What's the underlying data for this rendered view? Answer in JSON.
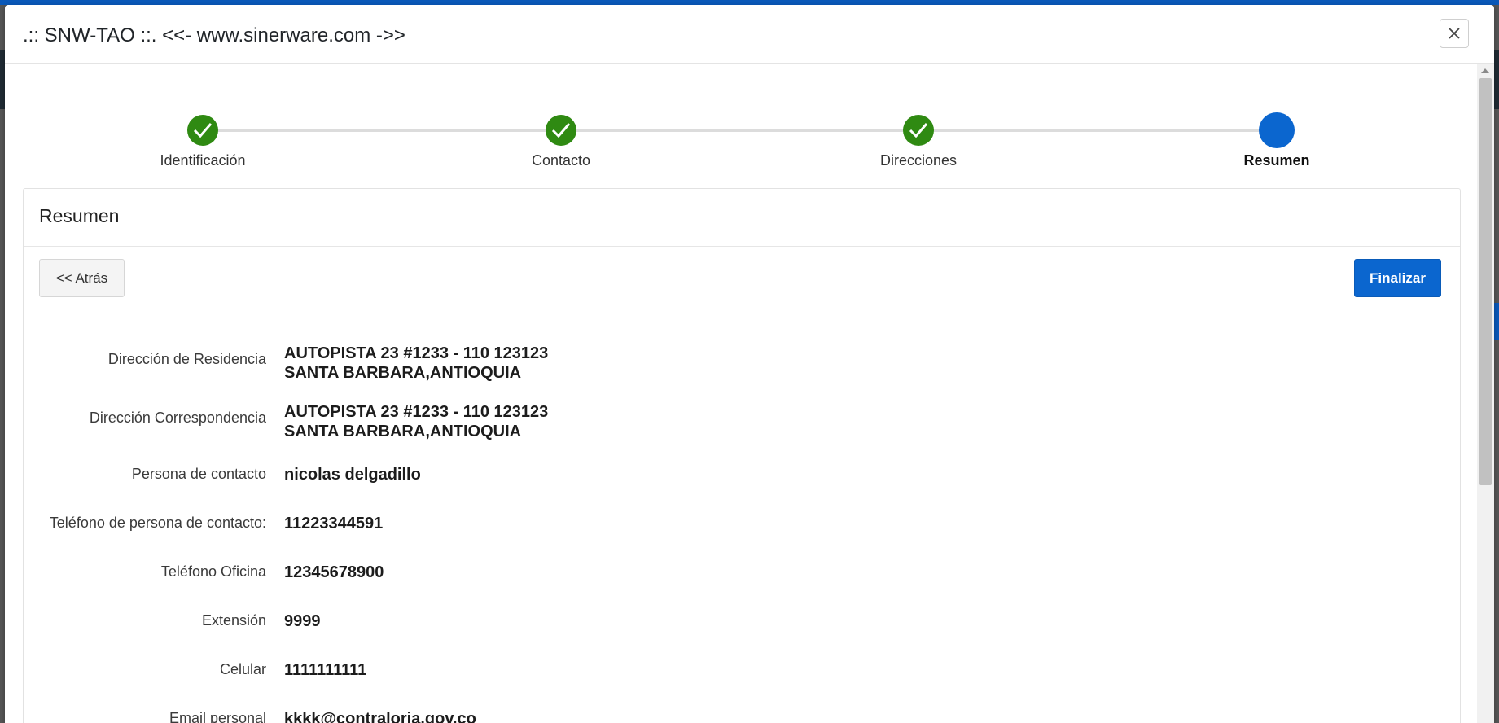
{
  "modal": {
    "title": ".:: SNW-TAO ::. <<- www.sinerware.com ->>"
  },
  "stepper": {
    "steps": [
      {
        "label": "Identificación",
        "status": "done"
      },
      {
        "label": "Contacto",
        "status": "done"
      },
      {
        "label": "Direcciones",
        "status": "done"
      },
      {
        "label": "Resumen",
        "status": "current"
      }
    ]
  },
  "card": {
    "title": "Resumen",
    "back_label": "<< Atrás",
    "finish_label": "Finalizar"
  },
  "summary": [
    {
      "label": "Dirección de Residencia",
      "value_line1": "AUTOPISTA 23 #1233 - 110 123123",
      "value_line2": "SANTA BARBARA,ANTIOQUIA"
    },
    {
      "label": "Dirección Correspondencia",
      "value_line1": "AUTOPISTA 23 #1233 - 110 123123",
      "value_line2": "SANTA BARBARA,ANTIOQUIA"
    },
    {
      "label": "Persona de contacto",
      "value_line1": "nicolas delgadillo"
    },
    {
      "label": "Teléfono de persona de contacto:",
      "value_line1": "11223344591"
    },
    {
      "label": "Teléfono Oficina",
      "value_line1": "12345678900"
    },
    {
      "label": "Extensión",
      "value_line1": "9999"
    },
    {
      "label": "Celular",
      "value_line1": "1111111111"
    },
    {
      "label": "Email personal",
      "value_line1": "kkkk@contraloria.gov.co"
    }
  ],
  "colors": {
    "accent": "#0b66cf",
    "done": "#2f8a12"
  }
}
